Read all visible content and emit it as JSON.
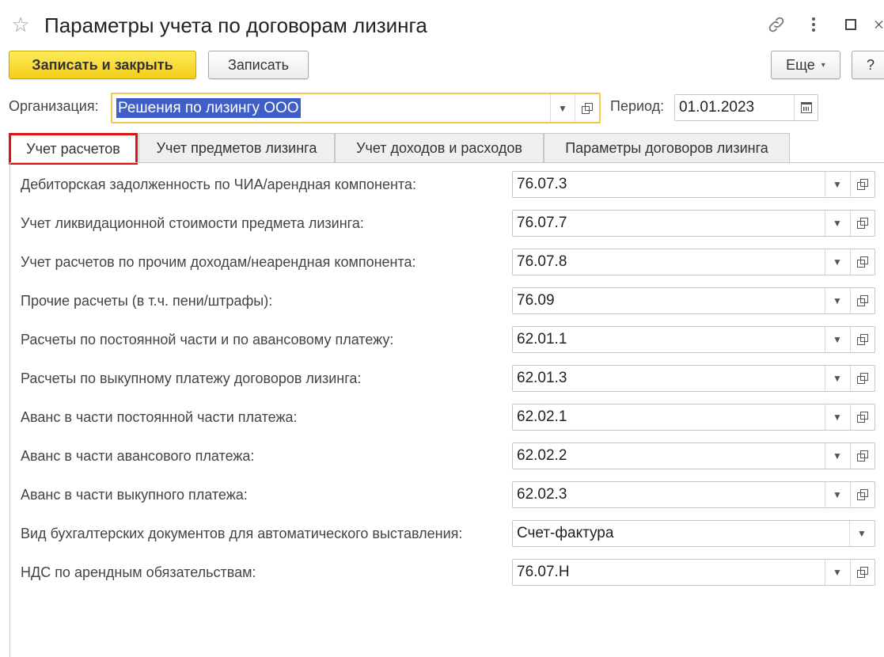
{
  "window": {
    "title": "Параметры учета по договорам лизинга",
    "icons": [
      "star-icon",
      "link-icon",
      "more-vertical-icon",
      "maximize-icon",
      "close-icon"
    ]
  },
  "toolbar": {
    "save_close_label": "Записать и закрыть",
    "save_label": "Записать",
    "more_label": "Еще",
    "help_label": "?"
  },
  "organization": {
    "label": "Организация:",
    "value": "Решения по лизингу ООО"
  },
  "period": {
    "label": "Период:",
    "value": "01.01.2023"
  },
  "tabs": [
    {
      "label": "Учет расчетов",
      "active": true
    },
    {
      "label": "Учет предметов лизинга",
      "active": false
    },
    {
      "label": "Учет доходов и расходов",
      "active": false
    },
    {
      "label": "Параметры договоров лизинга",
      "active": false
    }
  ],
  "rows": [
    {
      "label": "Дебиторская задолженность по ЧИА/арендная компонента:",
      "value": "76.07.3"
    },
    {
      "label": "Учет ликвидационной стоимости предмета лизинга:",
      "value": "76.07.7"
    },
    {
      "label": "Учет расчетов по прочим доходам/неарендная компонента:",
      "value": "76.07.8"
    },
    {
      "label": "Прочие расчеты (в т.ч. пени/штрафы):",
      "value": "76.09"
    },
    {
      "label": "Расчеты по постоянной части и по авансовому платежу:",
      "value": "62.01.1"
    },
    {
      "label": "Расчеты по выкупному платежу договоров лизинга:",
      "value": "62.01.3"
    },
    {
      "label": "Аванс в части постоянной части платежа:",
      "value": "62.02.1"
    },
    {
      "label": "Аванс в части авансового платежа:",
      "value": "62.02.2"
    },
    {
      "label": "Аванс в части выкупного платежа:",
      "value": "62.02.3"
    },
    {
      "label": "Вид бухгалтерских документов для автоматического выставления:",
      "value": "Счет-фактура"
    },
    {
      "label": "НДС по арендным обязательствам:",
      "value": "76.07.Н"
    }
  ],
  "colors": {
    "primary_button": "#f3cf1a",
    "active_tab_border": "#e01010",
    "selection": "#3f5ec8",
    "focus_border": "#f2c94c"
  }
}
